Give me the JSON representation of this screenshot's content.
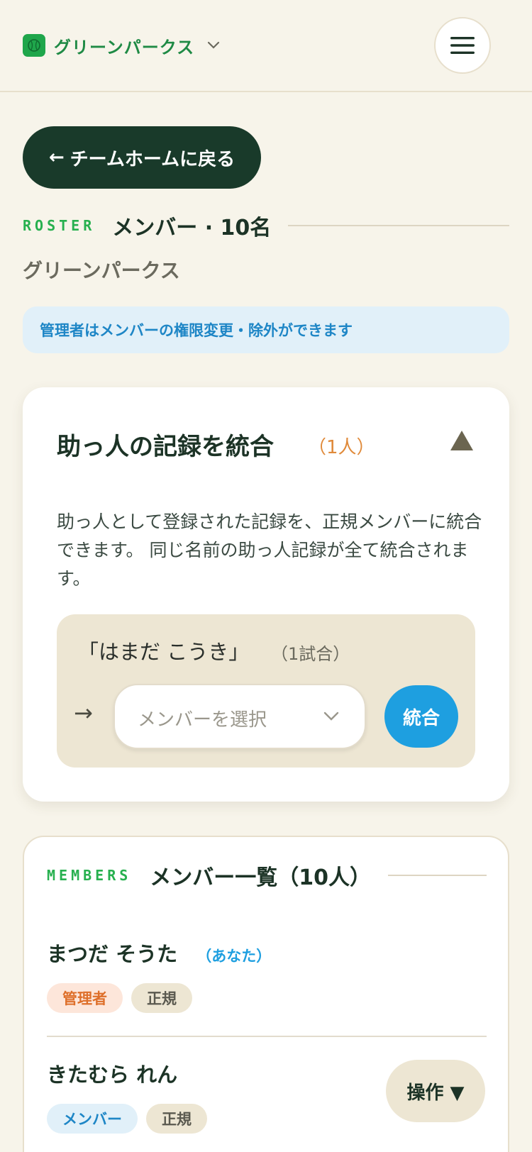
{
  "header": {
    "team_name": "グリーンパークス",
    "team_logo_icon": "baseball-icon",
    "menu_icon": "hamburger-menu-icon"
  },
  "back_button": {
    "arrow": "←",
    "label": "チームホームに戻る"
  },
  "roster": {
    "eyebrow": "ROSTER",
    "title": "メンバー · 10名",
    "team_name": "グリーンパークス",
    "notice": "管理者はメンバーの権限変更・除外ができます"
  },
  "merge_card": {
    "title": "助っ人の記録を統合",
    "count": "（1人）",
    "collapse_icon": "triangle-up-icon",
    "description": "助っ人として登録された記録を、正規メンバーに統合できます。 同じ名前の助っ人記録が全て統合されます。",
    "guest": {
      "name": "「はまだ こうき」",
      "games": "（1試合）",
      "arrow": "→",
      "select_placeholder": "メンバーを選択",
      "merge_label": "統合"
    }
  },
  "members": {
    "eyebrow": "MEMBERS",
    "title": "メンバー一覧（10人）",
    "list": [
      {
        "name": "まつだ そうた",
        "you_tag": "（あなた）",
        "role": "管理者",
        "type": "正規"
      },
      {
        "name": "きたむら れん",
        "role": "メンバー",
        "type": "正規",
        "action": "操作 ▼"
      }
    ]
  },
  "colors": {
    "background": "#f7f4ea",
    "brand_green": "#1f8a45",
    "dark_green": "#193a2a",
    "accent_blue": "#1e9fe0",
    "accent_orange": "#e08a3a"
  }
}
